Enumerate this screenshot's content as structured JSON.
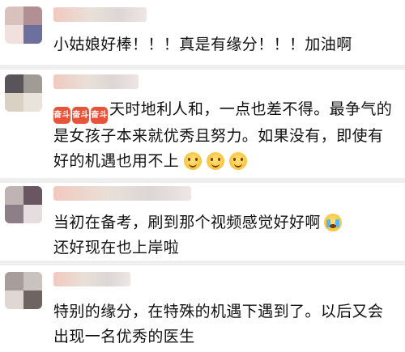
{
  "comments": [
    {
      "text": "小姑娘好棒！！！真是有缘分！！！加油啊",
      "avatar_colors": [
        "#d9c2bd",
        "#b18f92",
        "#f0e1de",
        "#6d6f9c"
      ],
      "name_blurred": true
    },
    {
      "badge_icons": [
        "fight-badge-icon",
        "fight-badge-icon",
        "fight-badge-icon"
      ],
      "badge_label": "奋斗",
      "text": "天时地利人和，一点也差不得。最争气的是女孩子本来就优秀且努力。如果没有，即使有好的机遇也用不上",
      "trailing_emoji": [
        "smile-emoji-icon",
        "smile-emoji-icon",
        "smile-emoji-icon"
      ],
      "avatar_colors": [
        "#58545a",
        "#a19b96",
        "#d8d1c4",
        "#e9e3db"
      ],
      "name_blurred": true
    },
    {
      "text": "当初在备考，刷到那个视频感觉好好啊",
      "text_line2": "还好现在也上岸啦",
      "trailing_emoji": [
        "crying-emoji-icon"
      ],
      "avatar_colors": [
        "#bfb3b4",
        "#6a5660",
        "#8c7f86",
        "#e6dede"
      ],
      "name_blurred": true
    },
    {
      "text": "特别的缘分，在特殊的机遇下遇到了。以后又会出现一名优秀的医生",
      "avatar_colors": [
        "#a79e9c",
        "#cac2bf",
        "#ded7d4",
        "#6e6563"
      ],
      "name_blurred": true
    }
  ],
  "colors": {
    "divider": "#eeeeee",
    "badge": "#e8543a",
    "text": "#111111"
  }
}
